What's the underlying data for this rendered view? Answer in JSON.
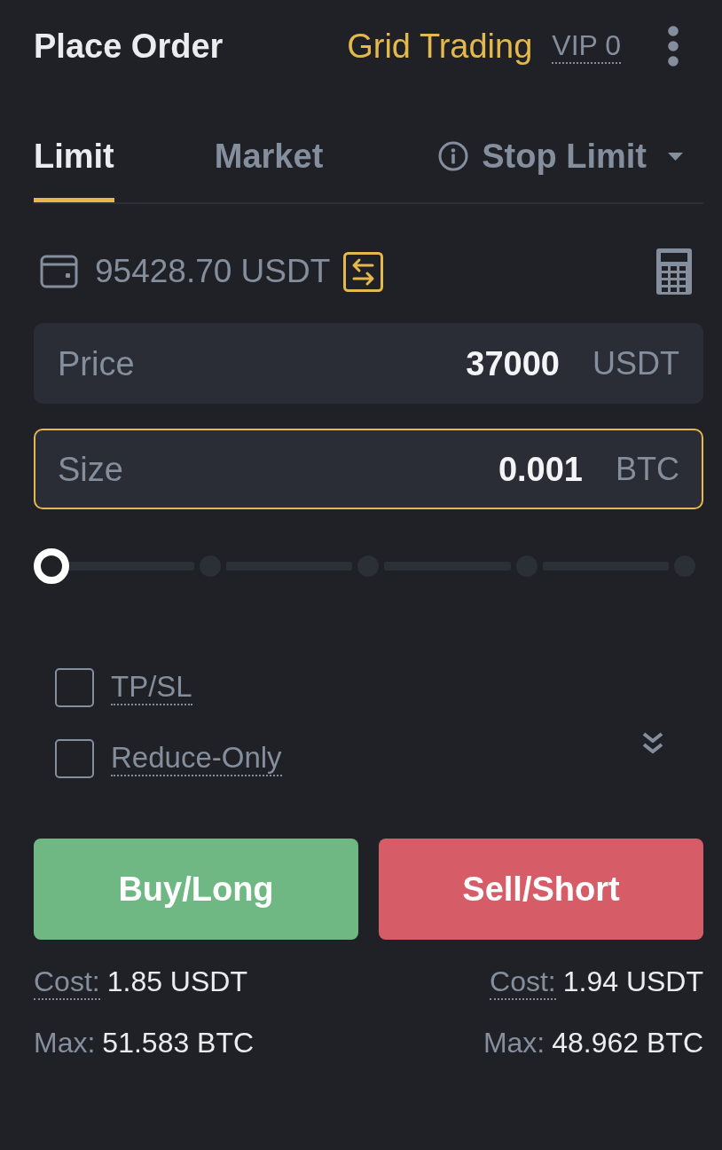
{
  "header": {
    "title": "Place Order",
    "link": "Grid Trading",
    "vip": "VIP 0"
  },
  "tabs": [
    {
      "label": "Limit",
      "selected": true,
      "kind": "plain"
    },
    {
      "label": "Market",
      "selected": false,
      "kind": "plain"
    },
    {
      "label": "Stop Limit",
      "selected": false,
      "kind": "dropdown"
    }
  ],
  "balance": "95428.70 USDT",
  "fields": [
    {
      "label": "Price",
      "value": "37000",
      "unit": "USDT",
      "focused": false
    },
    {
      "label": "Size",
      "value": "0.001",
      "unit": "BTC",
      "focused": true
    }
  ],
  "slider": {
    "level": 0
  },
  "options": [
    {
      "label": "TP/SL",
      "checked": false
    },
    {
      "label": "Reduce-Only",
      "checked": false
    }
  ],
  "actions": [
    {
      "label": "Buy/Long",
      "kind": "buy"
    },
    {
      "label": "Sell/Short",
      "kind": "sell"
    }
  ],
  "summary": [
    {
      "rows": [
        {
          "label": "Cost:",
          "value": "1.85 USDT",
          "kind": "hint"
        },
        {
          "label": "Max:",
          "value": "51.583 BTC",
          "kind": "plain"
        }
      ]
    },
    {
      "rows": [
        {
          "label": "Cost:",
          "value": "1.94 USDT",
          "kind": "hint"
        },
        {
          "label": "Max:",
          "value": "48.962 BTC",
          "kind": "plain"
        }
      ]
    }
  ]
}
